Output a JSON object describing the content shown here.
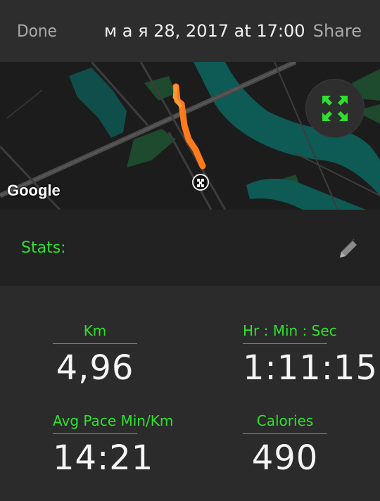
{
  "header": {
    "done_label": "Done",
    "title": "м а я  28, 2017 at 17:00",
    "share_label": "Share"
  },
  "map": {
    "attribution": "Google",
    "route_color": "#ff7a1a",
    "water_color": "#0e5a55",
    "park_color": "#1e4a2e"
  },
  "stats": {
    "label": "Stats:"
  },
  "metrics": [
    {
      "label": "Km",
      "value": "4,96"
    },
    {
      "label": "Hr : Min : Sec",
      "value": "1:11:15"
    },
    {
      "label": "Avg Pace Min/Km",
      "value": "14:21"
    },
    {
      "label": "Calories",
      "value": "490"
    }
  ],
  "accent_color": "#2ee02e"
}
